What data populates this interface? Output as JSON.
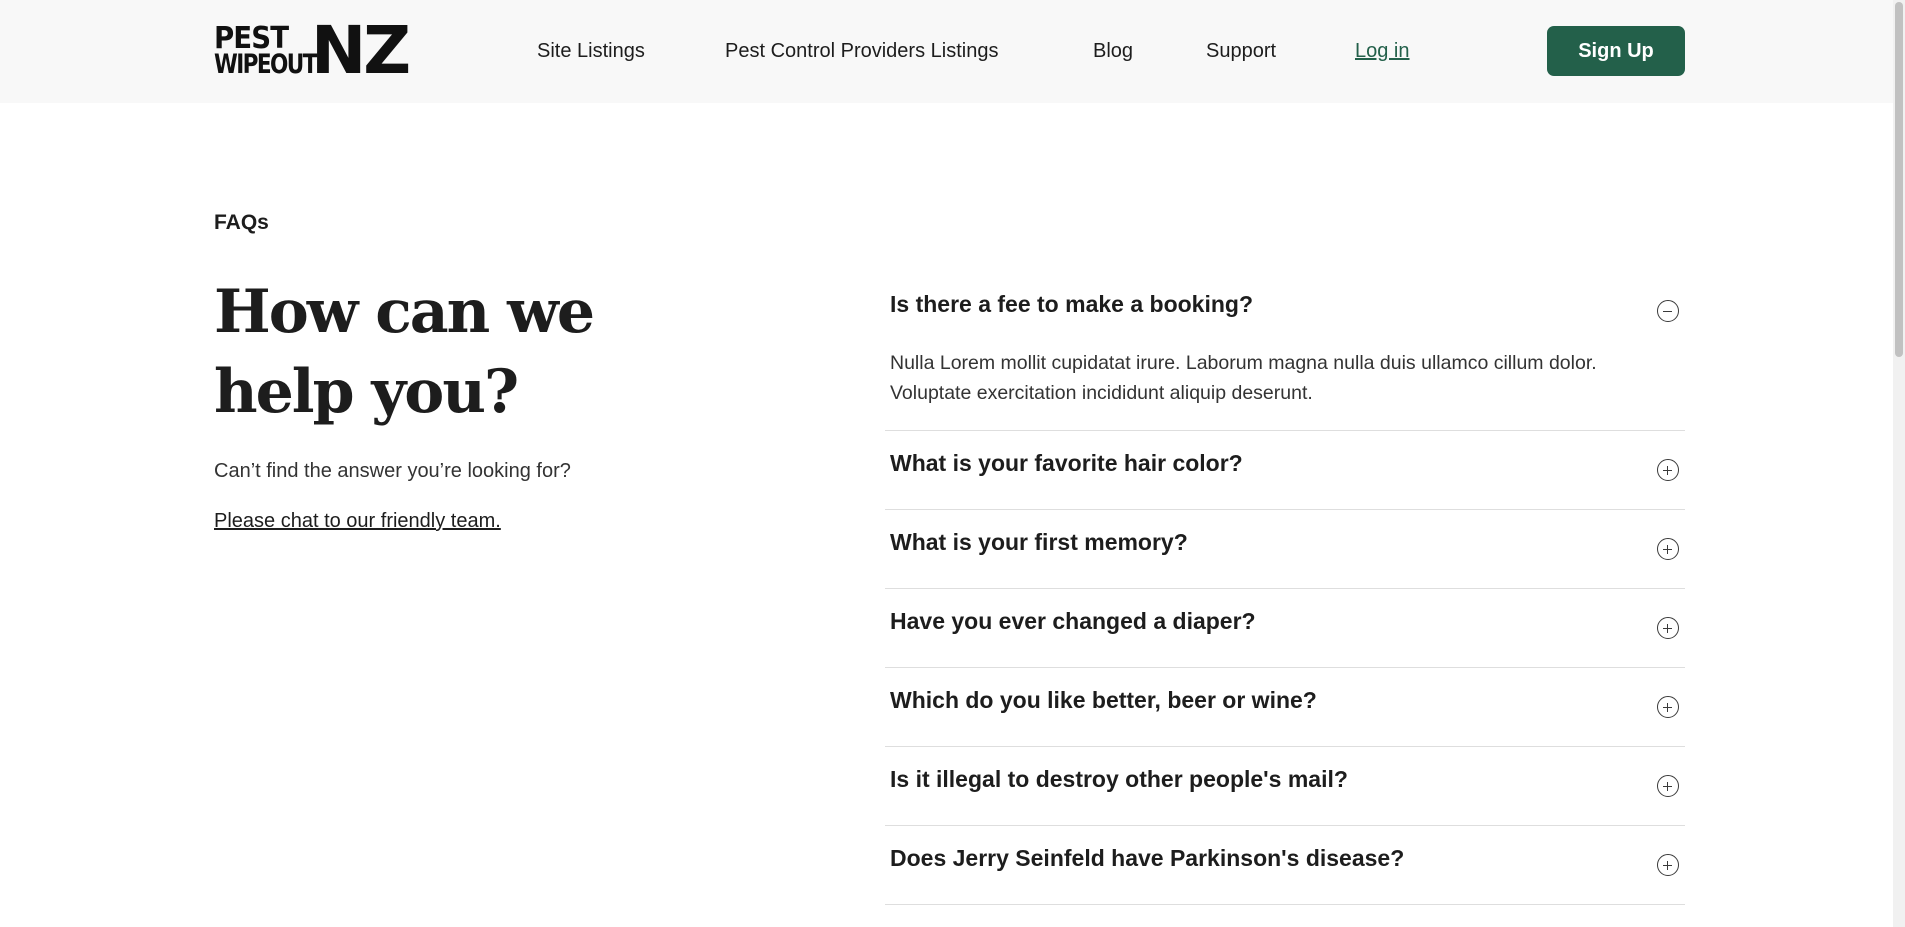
{
  "header": {
    "logo": {
      "line1": "PEST",
      "line2": "WIPEOUT",
      "mark": "NZ"
    },
    "nav": [
      {
        "label": "Site Listings"
      },
      {
        "label": "Pest Control Providers Listings"
      },
      {
        "label": "Blog"
      },
      {
        "label": "Support"
      }
    ],
    "login_label": "Log in",
    "signup_label": "Sign Up"
  },
  "intro": {
    "eyebrow": "FAQs",
    "heading": "How can we help you?",
    "subtext": "Can’t find the answer you’re looking for?",
    "chat_link": "Please chat to our friendly team."
  },
  "faqs": [
    {
      "question": "Is there a fee to make a booking?",
      "answer": "Nulla Lorem mollit cupidatat irure. Laborum magna nulla duis ullamco cillum dolor. Voluptate exercitation incididunt aliquip deserunt.",
      "expanded": true,
      "icon": "minus-circle-icon"
    },
    {
      "question": "What is your favorite hair color?",
      "expanded": false,
      "icon": "plus-circle-icon"
    },
    {
      "question": "What is your first memory?",
      "expanded": false,
      "icon": "plus-circle-icon"
    },
    {
      "question": "Have you ever changed a diaper?",
      "expanded": false,
      "icon": "plus-circle-icon"
    },
    {
      "question": "Which do you like better, beer or wine?",
      "expanded": false,
      "icon": "plus-circle-icon"
    },
    {
      "question": "Is it illegal to destroy other people's mail?",
      "expanded": false,
      "icon": "plus-circle-icon"
    },
    {
      "question": "Does Jerry Seinfeld have Parkinson's disease?",
      "expanded": false,
      "icon": "plus-circle-icon"
    }
  ],
  "colors": {
    "brand_green": "#23604a",
    "header_bg": "#f8f8f8",
    "text": "#1d1d1d"
  }
}
